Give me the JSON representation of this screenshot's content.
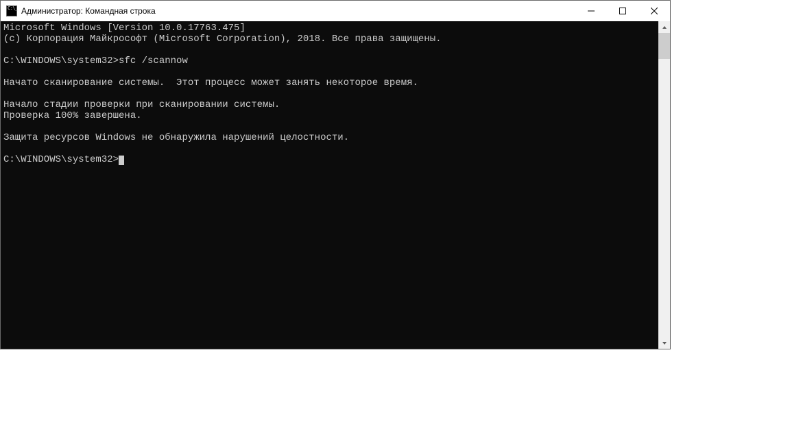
{
  "window": {
    "title": "Администратор: Командная строка"
  },
  "terminal": {
    "lines": [
      "Microsoft Windows [Version 10.0.17763.475]",
      "(c) Корпорация Майкрософт (Microsoft Corporation), 2018. Все права защищены.",
      "",
      "C:\\WINDOWS\\system32>sfc /scannow",
      "",
      "Начато сканирование системы.  Этот процесс может занять некоторое время.",
      "",
      "Начало стадии проверки при сканировании системы.",
      "Проверка 100% завершена.",
      "",
      "Защита ресурсов Windows не обнаружила нарушений целостности.",
      "",
      "C:\\WINDOWS\\system32>"
    ],
    "prompt_path": "C:\\WINDOWS\\system32>",
    "command": "sfc /scannow",
    "progress_percent": 100
  },
  "controls": {
    "minimize": "Minimize",
    "maximize": "Maximize",
    "close": "Close"
  }
}
